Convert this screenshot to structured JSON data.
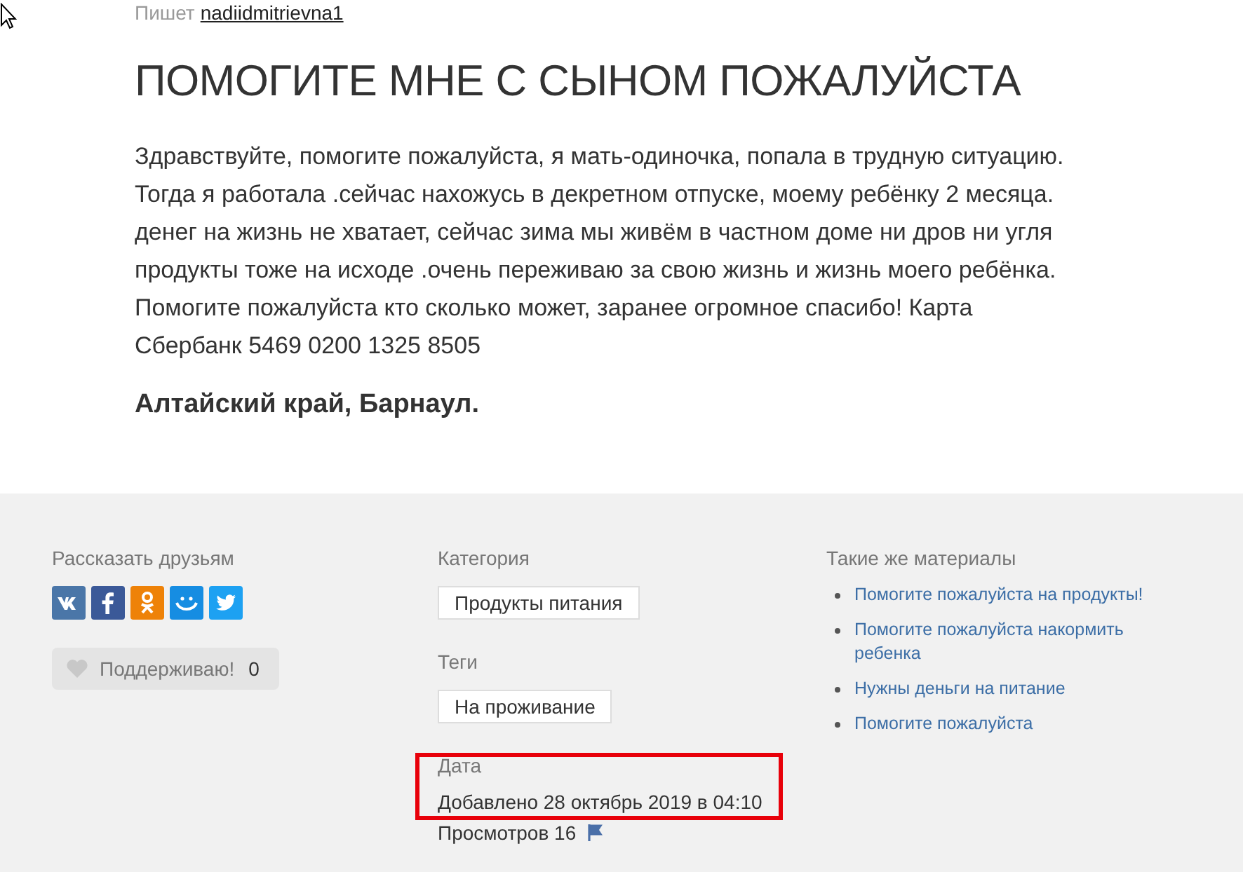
{
  "author": {
    "label": "Пишет",
    "name": "nadiidmitrievna1"
  },
  "title": "ПОМОГИТЕ МНЕ С СЫНОМ ПОЖАЛУЙСТА",
  "body": "Здравствуйте, помогите пожалуйста, я мать-одиночка, попала в трудную ситуацию. Тогда я работала .сейчас нахожусь в декретном отпуске, моему ребёнку 2 месяца. денег на жизнь не хватает, сейчас зима мы живём в частном доме ни дров ни угля продукты тоже на исходе .очень переживаю за свою жизнь и жизнь моего ребёнка. Помогите пожалуйста кто сколько может, заранее огромное спасибо! Карта Сбербанк 5469 0200 1325 8505",
  "location": "Алтайский край, Барнаул.",
  "share": {
    "title": "Рассказать друзьям",
    "networks": [
      {
        "kind": "vk",
        "color": "#4a76a8"
      },
      {
        "kind": "facebook",
        "color": "#3b5998"
      },
      {
        "kind": "ok",
        "color": "#ee8208"
      },
      {
        "kind": "mailru",
        "color": "#168de2"
      },
      {
        "kind": "twitter",
        "color": "#1da1f2"
      }
    ]
  },
  "support": {
    "label": "Поддерживаю!",
    "count": "0"
  },
  "category": {
    "title": "Категория",
    "value": "Продукты питания"
  },
  "tags": {
    "title": "Теги",
    "items": [
      "На проживание"
    ]
  },
  "date": {
    "title": "Дата",
    "added": "Добавлено 28 октябрь 2019 в 04:10",
    "views": "Просмотров 16"
  },
  "related": {
    "title": "Такие же материалы",
    "items": [
      "Помогите пожалуйста на продукты!",
      "Помогите пожалуйста накормить ребенка",
      "Нужны деньги на питание",
      "Помогите пожалуйста"
    ]
  }
}
